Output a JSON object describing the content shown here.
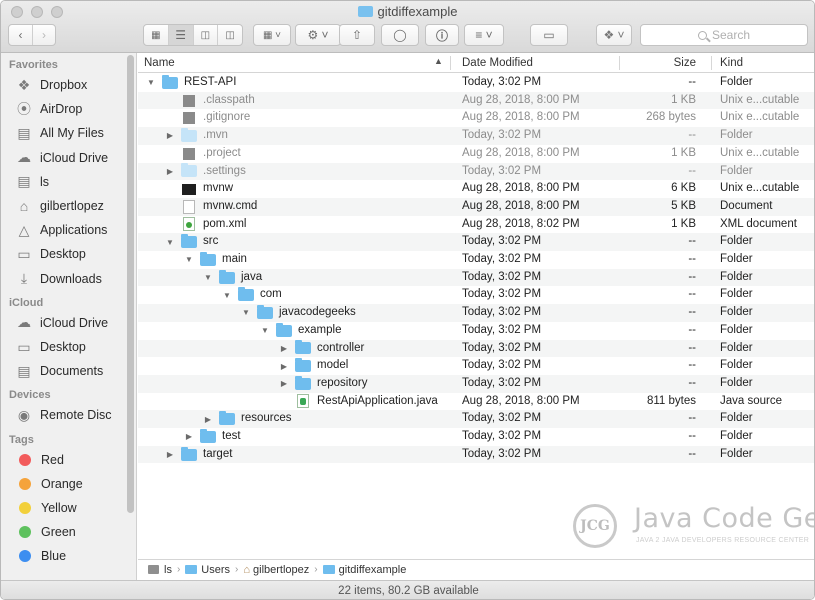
{
  "window": {
    "title": "gitdiffexample"
  },
  "toolbar": {
    "search_placeholder": "Search"
  },
  "sidebar": {
    "favorites_label": "Favorites",
    "favorites": [
      {
        "label": "Dropbox",
        "icon": "dropbox-icon"
      },
      {
        "label": "AirDrop",
        "icon": "airdrop-icon"
      },
      {
        "label": "All My Files",
        "icon": "all-files-icon"
      },
      {
        "label": "iCloud Drive",
        "icon": "cloud-icon"
      },
      {
        "label": "ls",
        "icon": "document-icon"
      },
      {
        "label": "gilbertlopez",
        "icon": "home-icon"
      },
      {
        "label": "Applications",
        "icon": "applications-icon"
      },
      {
        "label": "Desktop",
        "icon": "desktop-icon"
      },
      {
        "label": "Downloads",
        "icon": "downloads-icon"
      }
    ],
    "icloud_label": "iCloud",
    "icloud": [
      {
        "label": "iCloud Drive",
        "icon": "cloud-icon"
      },
      {
        "label": "Desktop",
        "icon": "desktop-icon"
      },
      {
        "label": "Documents",
        "icon": "documents-icon"
      }
    ],
    "devices_label": "Devices",
    "devices": [
      {
        "label": "Remote Disc",
        "icon": "disc-icon"
      }
    ],
    "tags_label": "Tags",
    "tags": [
      {
        "label": "Red",
        "color": "#f25b5b"
      },
      {
        "label": "Orange",
        "color": "#f5a33b"
      },
      {
        "label": "Yellow",
        "color": "#f2d03b"
      },
      {
        "label": "Green",
        "color": "#5ec15e"
      },
      {
        "label": "Blue",
        "color": "#3d8ef0"
      }
    ]
  },
  "columns": {
    "name": "Name",
    "date": "Date Modified",
    "size": "Size",
    "kind": "Kind"
  },
  "files": [
    {
      "name": "REST-API",
      "date": "Today, 3:02 PM",
      "size": "--",
      "kind": "Folder",
      "level": 0,
      "icon": "folder",
      "disclosure": "open",
      "dim": false
    },
    {
      "name": ".classpath",
      "date": "Aug 28, 2018, 8:00 PM",
      "size": "1 KB",
      "kind": "Unix e...cutable",
      "level": 1,
      "icon": "grey",
      "disclosure": "none",
      "dim": true
    },
    {
      "name": ".gitignore",
      "date": "Aug 28, 2018, 8:00 PM",
      "size": "268 bytes",
      "kind": "Unix e...cutable",
      "level": 1,
      "icon": "grey",
      "disclosure": "none",
      "dim": true
    },
    {
      "name": ".mvn",
      "date": "Today, 3:02 PM",
      "size": "--",
      "kind": "Folder",
      "level": 1,
      "icon": "folder-dim",
      "disclosure": "closed",
      "dim": true
    },
    {
      "name": ".project",
      "date": "Aug 28, 2018, 8:00 PM",
      "size": "1 KB",
      "kind": "Unix e...cutable",
      "level": 1,
      "icon": "grey",
      "disclosure": "none",
      "dim": true
    },
    {
      "name": ".settings",
      "date": "Today, 3:02 PM",
      "size": "--",
      "kind": "Folder",
      "level": 1,
      "icon": "folder-dim",
      "disclosure": "closed",
      "dim": true
    },
    {
      "name": "mvnw",
      "date": "Aug 28, 2018, 8:00 PM",
      "size": "6 KB",
      "kind": "Unix e...cutable",
      "level": 1,
      "icon": "exec",
      "disclosure": "none",
      "dim": false
    },
    {
      "name": "mvnw.cmd",
      "date": "Aug 28, 2018, 8:00 PM",
      "size": "5 KB",
      "kind": "Document",
      "level": 1,
      "icon": "file",
      "disclosure": "none",
      "dim": false
    },
    {
      "name": "pom.xml",
      "date": "Aug 28, 2018, 8:02 PM",
      "size": "1 KB",
      "kind": "XML document",
      "level": 1,
      "icon": "xml",
      "disclosure": "none",
      "dim": false
    },
    {
      "name": "src",
      "date": "Today, 3:02 PM",
      "size": "--",
      "kind": "Folder",
      "level": 1,
      "icon": "folder",
      "disclosure": "open",
      "dim": false
    },
    {
      "name": "main",
      "date": "Today, 3:02 PM",
      "size": "--",
      "kind": "Folder",
      "level": 2,
      "icon": "folder",
      "disclosure": "open",
      "dim": false
    },
    {
      "name": "java",
      "date": "Today, 3:02 PM",
      "size": "--",
      "kind": "Folder",
      "level": 3,
      "icon": "folder",
      "disclosure": "open",
      "dim": false
    },
    {
      "name": "com",
      "date": "Today, 3:02 PM",
      "size": "--",
      "kind": "Folder",
      "level": 4,
      "icon": "folder",
      "disclosure": "open",
      "dim": false
    },
    {
      "name": "javacodegeeks",
      "date": "Today, 3:02 PM",
      "size": "--",
      "kind": "Folder",
      "level": 5,
      "icon": "folder",
      "disclosure": "open",
      "dim": false
    },
    {
      "name": "example",
      "date": "Today, 3:02 PM",
      "size": "--",
      "kind": "Folder",
      "level": 6,
      "icon": "folder",
      "disclosure": "open",
      "dim": false
    },
    {
      "name": "controller",
      "date": "Today, 3:02 PM",
      "size": "--",
      "kind": "Folder",
      "level": 7,
      "icon": "folder",
      "disclosure": "closed",
      "dim": false
    },
    {
      "name": "model",
      "date": "Today, 3:02 PM",
      "size": "--",
      "kind": "Folder",
      "level": 7,
      "icon": "folder",
      "disclosure": "closed",
      "dim": false
    },
    {
      "name": "repository",
      "date": "Today, 3:02 PM",
      "size": "--",
      "kind": "Folder",
      "level": 7,
      "icon": "folder",
      "disclosure": "closed",
      "dim": false
    },
    {
      "name": "RestApiApplication.java",
      "date": "Aug 28, 2018, 8:00 PM",
      "size": "811 bytes",
      "kind": "Java source",
      "level": 7,
      "icon": "java",
      "disclosure": "none",
      "dim": false
    },
    {
      "name": "resources",
      "date": "Today, 3:02 PM",
      "size": "--",
      "kind": "Folder",
      "level": 3,
      "icon": "folder",
      "disclosure": "closed",
      "dim": false
    },
    {
      "name": "test",
      "date": "Today, 3:02 PM",
      "size": "--",
      "kind": "Folder",
      "level": 2,
      "icon": "folder",
      "disclosure": "closed",
      "dim": false
    },
    {
      "name": "target",
      "date": "Today, 3:02 PM",
      "size": "--",
      "kind": "Folder",
      "level": 1,
      "icon": "folder",
      "disclosure": "closed",
      "dim": false
    }
  ],
  "path": [
    {
      "label": "ls",
      "icon": "disk"
    },
    {
      "label": "Users",
      "icon": "folder"
    },
    {
      "label": "gilbertlopez",
      "icon": "home"
    },
    {
      "label": "gitdiffexample",
      "icon": "folder"
    }
  ],
  "status": "22 items, 80.2 GB available",
  "watermark": {
    "initials": "JCG",
    "title": "Java Code Geeks",
    "tagline": "JAVA 2 JAVA DEVELOPERS RESOURCE CENTER"
  }
}
